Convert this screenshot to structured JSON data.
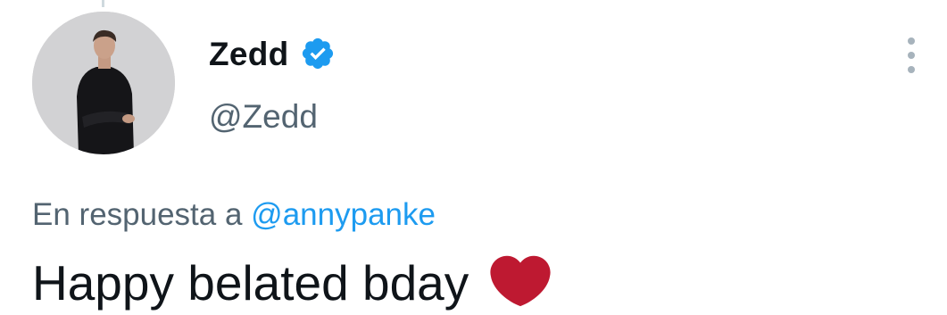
{
  "tweet": {
    "author": {
      "display_name": "Zedd",
      "handle": "@Zedd",
      "verified": true,
      "avatar_icon": "profile-photo"
    },
    "reply_to": {
      "prefix": "En respuesta a",
      "mention": "@annypanke"
    },
    "text": "Happy belated bday",
    "emoji": "heart-icon"
  },
  "colors": {
    "text": "#0f1419",
    "secondary": "#536471",
    "link": "#1d9bf0",
    "verified": "#1d9bf0",
    "heart": "#be1931"
  }
}
